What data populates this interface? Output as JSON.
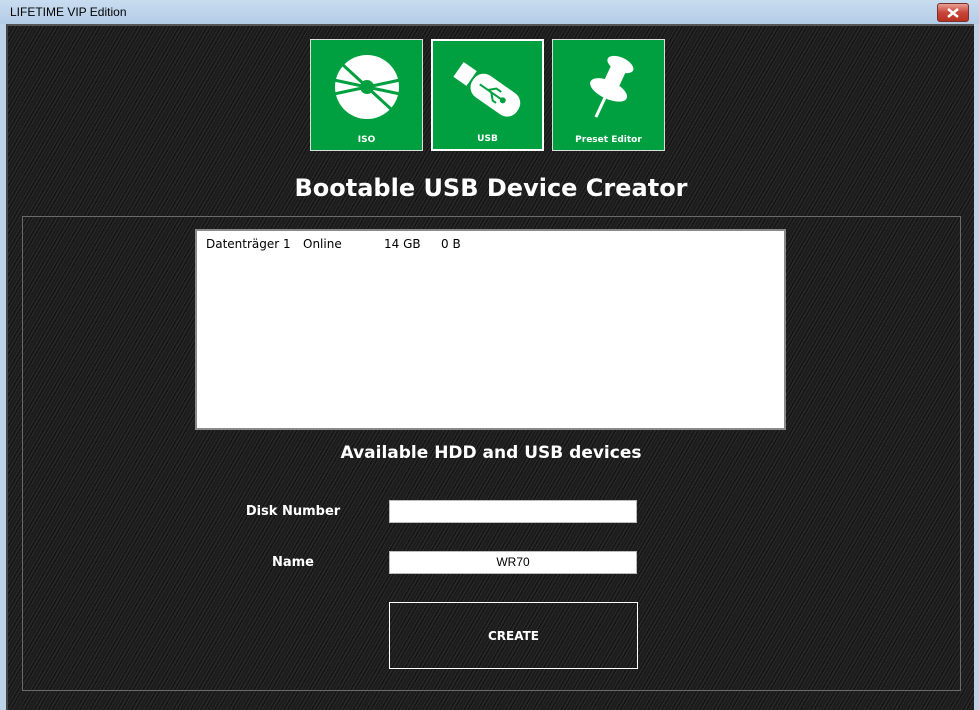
{
  "window": {
    "title": "LIFETIME VIP Edition",
    "close_icon": "close-x-icon"
  },
  "tiles": [
    {
      "label": "ISO",
      "icon": "disc-icon",
      "active": false
    },
    {
      "label": "USB",
      "icon": "usb-drive-icon",
      "active": true
    },
    {
      "label": "Preset Editor",
      "icon": "pushpin-icon",
      "active": false
    }
  ],
  "main": {
    "title": "Bootable USB Device Creator",
    "devices_caption": "Available HDD and USB devices",
    "devices": [
      {
        "name": "Datenträger 1",
        "status": "Online",
        "size": "14 GB",
        "free": "0 B"
      }
    ],
    "form": {
      "disk_number_label": "Disk Number",
      "disk_number_value": "",
      "name_label": "Name",
      "name_value": "WR70",
      "create_label": "CREATE"
    }
  },
  "colors": {
    "tile_green": "#00a040",
    "background": "#1c1c1c"
  }
}
